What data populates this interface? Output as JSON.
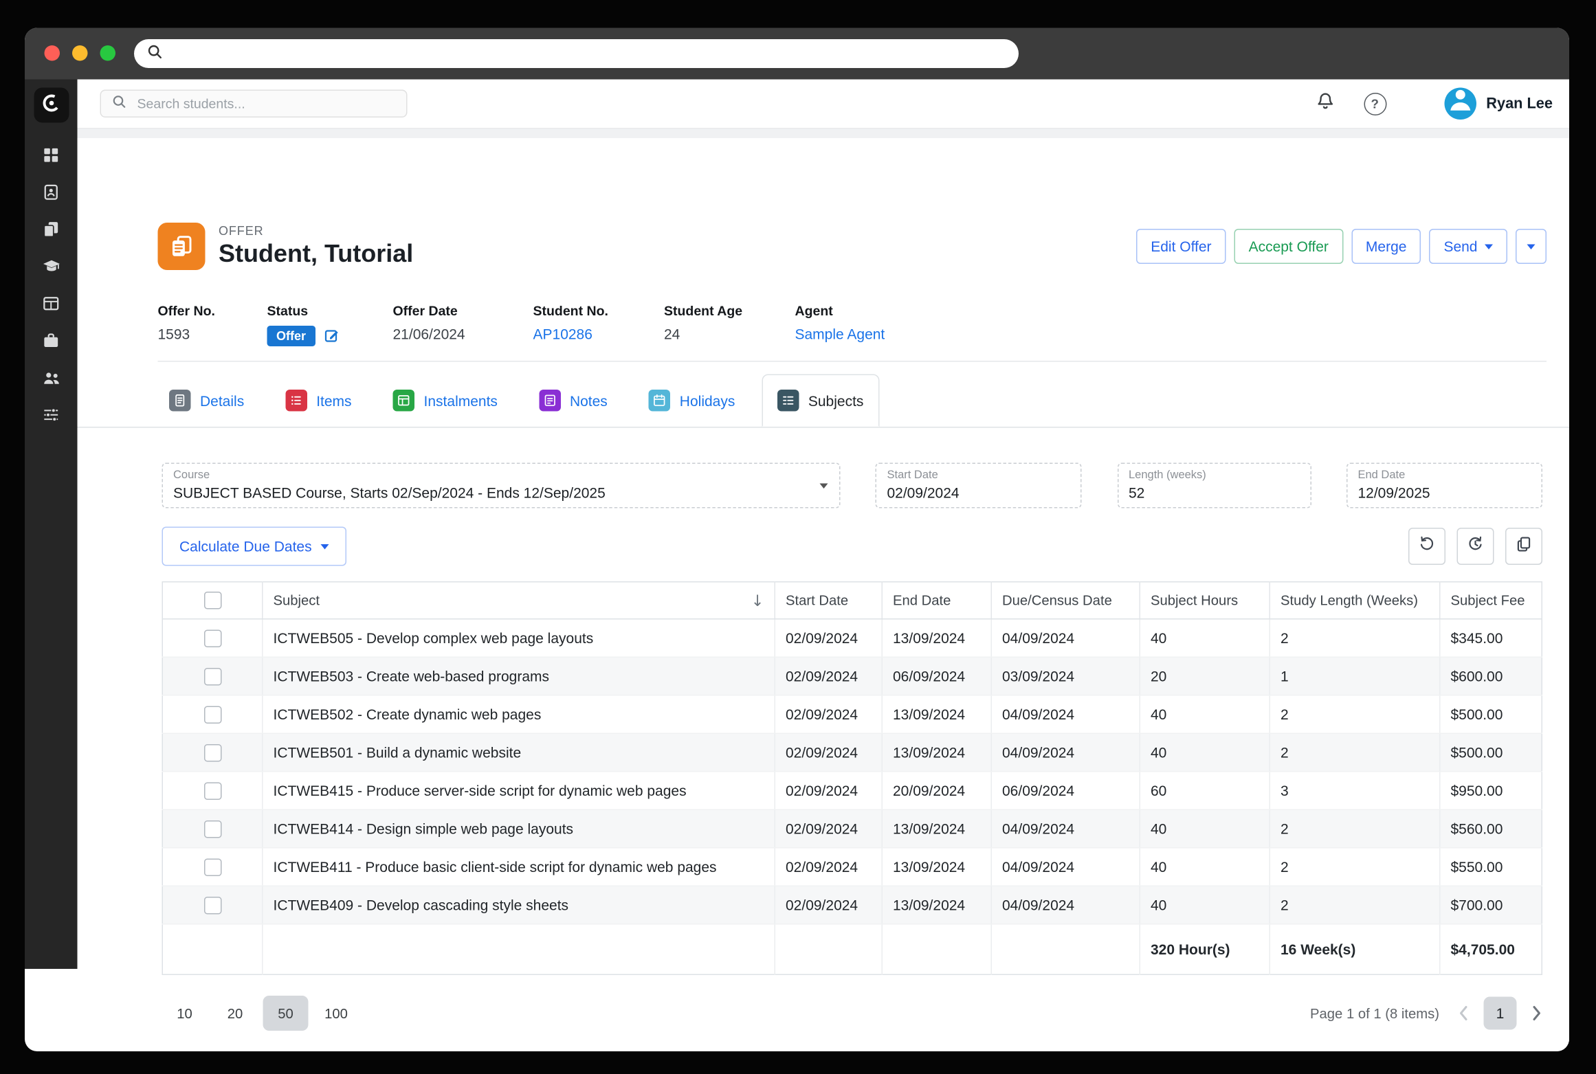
{
  "titlebar": {
    "traffic_lights": {
      "close": "#ff5f57",
      "minimize": "#febc2e",
      "zoom": "#28c840"
    }
  },
  "header": {
    "search_placeholder": "Search students...",
    "user_name": "Ryan Lee"
  },
  "offer": {
    "kicker": "OFFER",
    "title": "Student, Tutorial",
    "actions": {
      "edit": "Edit Offer",
      "accept": "Accept Offer",
      "merge": "Merge",
      "send": "Send"
    },
    "info": {
      "offer_no": {
        "label": "Offer No.",
        "value": "1593"
      },
      "status": {
        "label": "Status",
        "value": "Offer"
      },
      "offer_date": {
        "label": "Offer Date",
        "value": "21/06/2024"
      },
      "student_no": {
        "label": "Student No.",
        "value": "AP10286"
      },
      "student_age": {
        "label": "Student Age",
        "value": "24"
      },
      "agent": {
        "label": "Agent",
        "value": "Sample Agent"
      }
    }
  },
  "tabs": [
    {
      "label": "Details",
      "color": "#6e7781",
      "active": false
    },
    {
      "label": "Items",
      "color": "#d93444",
      "active": false
    },
    {
      "label": "Instalments",
      "color": "#28a745",
      "active": false
    },
    {
      "label": "Notes",
      "color": "#8a2fd4",
      "active": false
    },
    {
      "label": "Holidays",
      "color": "#54b6d8",
      "active": false
    },
    {
      "label": "Subjects",
      "color": "#3a5663",
      "active": true
    }
  ],
  "form": {
    "course": {
      "label": "Course",
      "value": "SUBJECT BASED Course, Starts 02/Sep/2024 - Ends 12/Sep/2025"
    },
    "start_date": {
      "label": "Start Date",
      "value": "02/09/2024"
    },
    "length_weeks": {
      "label": "Length (weeks)",
      "value": "52"
    },
    "end_date": {
      "label": "End Date",
      "value": "12/09/2025"
    }
  },
  "toolbar": {
    "calculate_label": "Calculate Due Dates"
  },
  "table": {
    "columns": [
      "Subject",
      "Start Date",
      "End Date",
      "Due/Census Date",
      "Subject Hours",
      "Study Length (Weeks)",
      "Subject Fee"
    ],
    "rows": [
      {
        "subject": "ICTWEB505 - Develop complex web page layouts",
        "start": "02/09/2024",
        "end": "13/09/2024",
        "due": "04/09/2024",
        "hours": "40",
        "weeks": "2",
        "fee": "$345.00"
      },
      {
        "subject": "ICTWEB503 - Create web-based programs",
        "start": "02/09/2024",
        "end": "06/09/2024",
        "due": "03/09/2024",
        "hours": "20",
        "weeks": "1",
        "fee": "$600.00"
      },
      {
        "subject": "ICTWEB502 - Create dynamic web pages",
        "start": "02/09/2024",
        "end": "13/09/2024",
        "due": "04/09/2024",
        "hours": "40",
        "weeks": "2",
        "fee": "$500.00"
      },
      {
        "subject": "ICTWEB501 - Build a dynamic website",
        "start": "02/09/2024",
        "end": "13/09/2024",
        "due": "04/09/2024",
        "hours": "40",
        "weeks": "2",
        "fee": "$500.00"
      },
      {
        "subject": "ICTWEB415 - Produce server-side script for dynamic web pages",
        "start": "02/09/2024",
        "end": "20/09/2024",
        "due": "06/09/2024",
        "hours": "60",
        "weeks": "3",
        "fee": "$950.00"
      },
      {
        "subject": "ICTWEB414 - Design simple web page layouts",
        "start": "02/09/2024",
        "end": "13/09/2024",
        "due": "04/09/2024",
        "hours": "40",
        "weeks": "2",
        "fee": "$560.00"
      },
      {
        "subject": "ICTWEB411 - Produce basic client-side script for dynamic web pages",
        "start": "02/09/2024",
        "end": "13/09/2024",
        "due": "04/09/2024",
        "hours": "40",
        "weeks": "2",
        "fee": "$550.00"
      },
      {
        "subject": "ICTWEB409 - Develop cascading style sheets",
        "start": "02/09/2024",
        "end": "13/09/2024",
        "due": "04/09/2024",
        "hours": "40",
        "weeks": "2",
        "fee": "$700.00"
      }
    ],
    "summary": {
      "hours": "320 Hour(s)",
      "weeks": "16 Week(s)",
      "fee": "$4,705.00"
    }
  },
  "pagination": {
    "sizes": [
      "10",
      "20",
      "50",
      "100"
    ],
    "active_size": "50",
    "info": "Page 1 of 1 (8 items)",
    "current_page": "1"
  },
  "colors": {
    "accent_blue": "#2563eb",
    "link_blue": "#1a73e8",
    "accent_green": "#189a52",
    "status_badge": "#1976d2",
    "offer_icon": "#ef8220",
    "avatar": "#1d9fd9",
    "sidebar": "#262626"
  },
  "icons": {
    "search": "magnifier",
    "notifications": "bell",
    "help": "question-mark-circle",
    "user": "person-avatar",
    "sort": "arrow-down",
    "refresh": "circular-arrows",
    "history": "clock-undo",
    "duplicate": "copy",
    "dropdown": "caret-down",
    "edit_status": "pencil-square"
  }
}
